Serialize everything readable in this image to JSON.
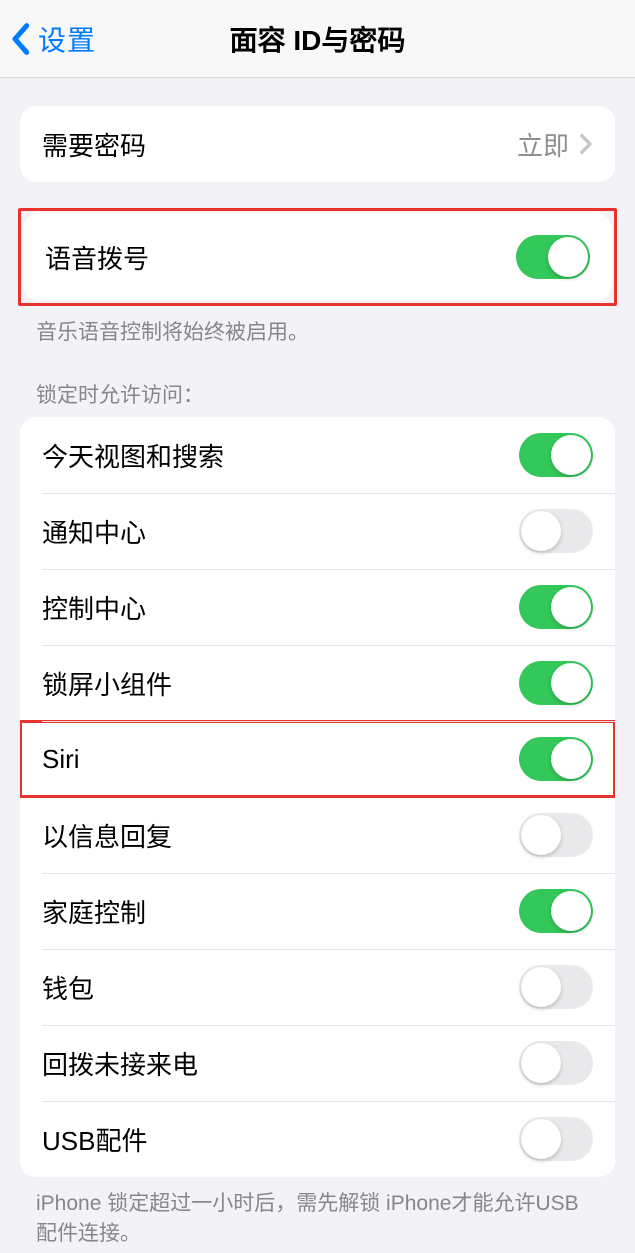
{
  "navbar": {
    "back_label": "设置",
    "title": "面容 ID与密码"
  },
  "passcode_row": {
    "label": "需要密码",
    "value": "立即"
  },
  "voice_dial": {
    "label": "语音拨号",
    "footer": "音乐语音控制将始终被启用。"
  },
  "lock_access": {
    "header": "锁定时允许访问：",
    "items": [
      {
        "label": "今天视图和搜索",
        "on": true
      },
      {
        "label": "通知中心",
        "on": false
      },
      {
        "label": "控制中心",
        "on": true
      },
      {
        "label": "锁屏小组件",
        "on": true
      },
      {
        "label": "Siri",
        "on": true
      },
      {
        "label": "以信息回复",
        "on": false
      },
      {
        "label": "家庭控制",
        "on": true
      },
      {
        "label": "钱包",
        "on": false
      },
      {
        "label": "回拨未接来电",
        "on": false
      },
      {
        "label": "USB配件",
        "on": false
      }
    ],
    "footer": "iPhone 锁定超过一小时后，需先解锁 iPhone才能允许USB 配件连接。"
  }
}
